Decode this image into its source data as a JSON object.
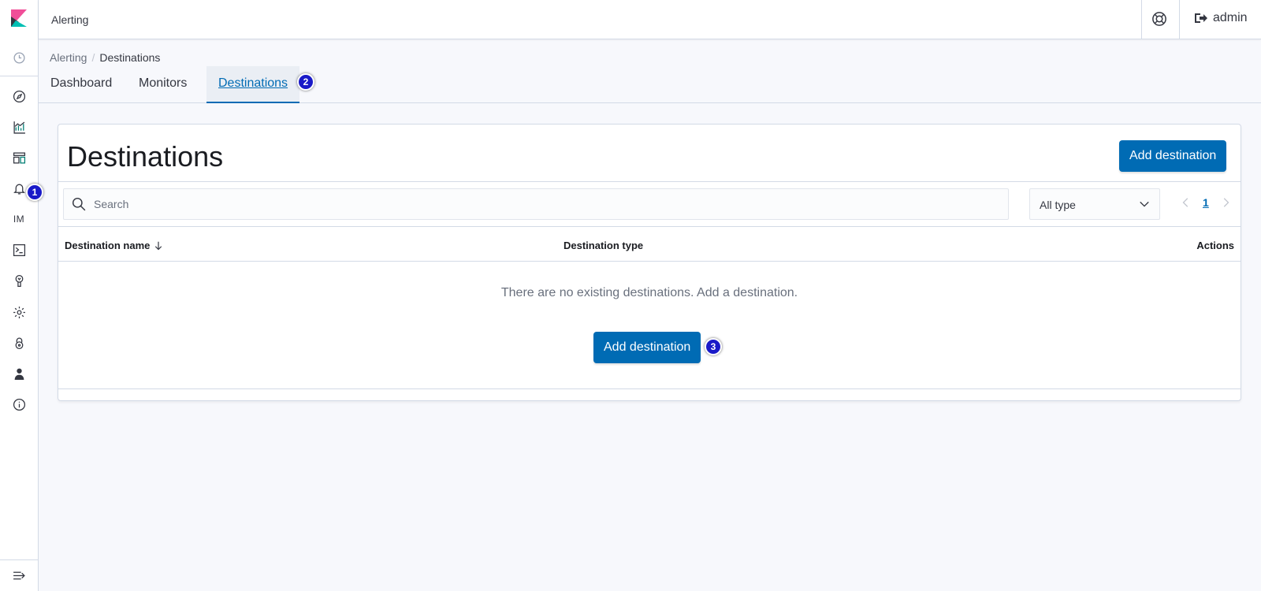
{
  "app": {
    "header_title": "Alerting",
    "user_label": "admin",
    "brand_colors": {
      "primary": "#006bb4",
      "badge": "#1a1ac8"
    }
  },
  "sidebar": {
    "icons": [
      {
        "name": "recent-icon"
      },
      {
        "name": "discover-icon"
      },
      {
        "name": "visualize-icon"
      },
      {
        "name": "dashboard-icon"
      },
      {
        "name": "alerting-bell-icon"
      },
      {
        "name": "im-text",
        "text": "IM"
      },
      {
        "name": "dev-tools-icon"
      },
      {
        "name": "monitoring-icon"
      },
      {
        "name": "management-gear-icon"
      },
      {
        "name": "security-lock-icon"
      },
      {
        "name": "user-icon"
      },
      {
        "name": "info-icon"
      },
      {
        "name": "collapse-nav-icon"
      }
    ]
  },
  "breadcrumb": {
    "parent": "Alerting",
    "separator": "/",
    "current": "Destinations"
  },
  "tabs": [
    {
      "label": "Dashboard",
      "active": false
    },
    {
      "label": "Monitors",
      "active": false
    },
    {
      "label": "Destinations",
      "active": true
    }
  ],
  "badges": {
    "one": "1",
    "two": "2",
    "three": "3"
  },
  "panel": {
    "title": "Destinations",
    "add_button": "Add destination",
    "search_placeholder": "Search",
    "type_filter": "All type",
    "pager_page": "1",
    "columns": [
      "Destination name",
      "Destination type",
      "Actions"
    ],
    "empty_message": "There are no existing destinations. Add a destination.",
    "empty_add_button": "Add destination"
  }
}
